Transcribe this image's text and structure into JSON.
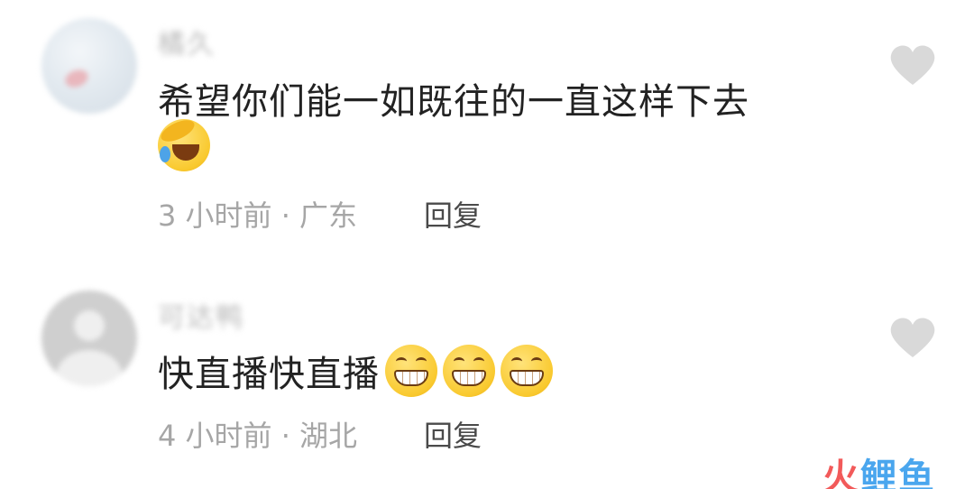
{
  "comments": [
    {
      "username": "橘久",
      "text": "希望你们能一如既往的一直这样下去",
      "emoji": "laughing-crying-emoji",
      "meta": "3 小时前 · 广东",
      "reply_label": "回复"
    },
    {
      "username": "可达鸭",
      "text": "快直播快直播",
      "emoji": "grinning-emoji",
      "meta": "4 小时前 · 湖北",
      "reply_label": "回复"
    }
  ],
  "watermark": {
    "part1": "火",
    "part2": "鲤鱼"
  },
  "colors": {
    "meta_text": "#a6a6a6",
    "comment_text": "#222222",
    "heart": "#d9d9d9",
    "watermark_red": "#f25a5a",
    "watermark_blue": "#4aa6ee"
  },
  "icons": [
    "heart-icon"
  ]
}
